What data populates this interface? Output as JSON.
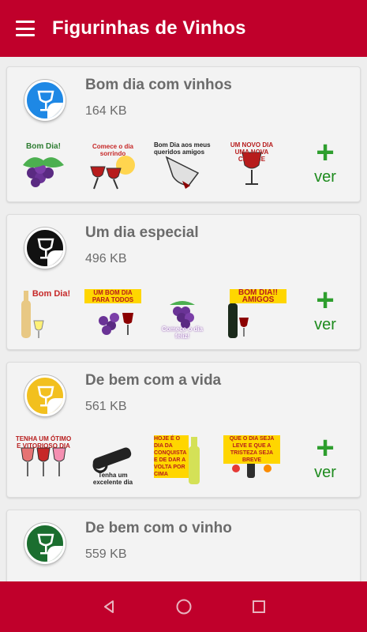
{
  "app": {
    "title": "Figurinhas de Vinhos"
  },
  "icons": {
    "menu": "menu-icon",
    "plus": "plus-icon",
    "back": "back-icon",
    "home": "home-icon",
    "recents": "recents-icon"
  },
  "colors": {
    "primary": "#c0002b",
    "green": "#2e9e2e"
  },
  "packs": [
    {
      "name": "Bom dia com vinhos",
      "size": "164 KB",
      "icon_color": "#1e88e5",
      "action_plus": "+",
      "action_label": "ver",
      "stickers": [
        {
          "caption": "Bom Dia!"
        },
        {
          "caption": "Comece o dia sorrindo"
        },
        {
          "caption": "Bom Dia aos meus queridos amigos"
        },
        {
          "caption": "UM NOVO DIA UMA NOVA CHANCE"
        }
      ]
    },
    {
      "name": "Um dia especial",
      "size": "496 KB",
      "icon_color": "#111111",
      "action_plus": "+",
      "action_label": "ver",
      "stickers": [
        {
          "caption": "Bom Dia!"
        },
        {
          "caption": "UM BOM DIA PARA TODOS"
        },
        {
          "caption": "Comece o dia feliz!"
        },
        {
          "caption": "BOM DIA!! AMIGOS"
        }
      ]
    },
    {
      "name": "De bem com a vida",
      "size": "561 KB",
      "icon_color": "#f2c01e",
      "action_plus": "+",
      "action_label": "ver",
      "stickers": [
        {
          "caption": "TENHA UM ÓTIMO E VITORIOSO DIA"
        },
        {
          "caption": "Tenha um excelente dia"
        },
        {
          "caption": "HOJE É O DIA DA CONQUISTA E DE DAR A VOLTA POR CIMA"
        },
        {
          "caption": "QUE O DIA SEJA LEVE E QUE A TRISTEZA SEJA BREVE"
        }
      ]
    },
    {
      "name": "De bem com o vinho",
      "size": "559 KB",
      "icon_color": "#1b6e2f"
    }
  ]
}
